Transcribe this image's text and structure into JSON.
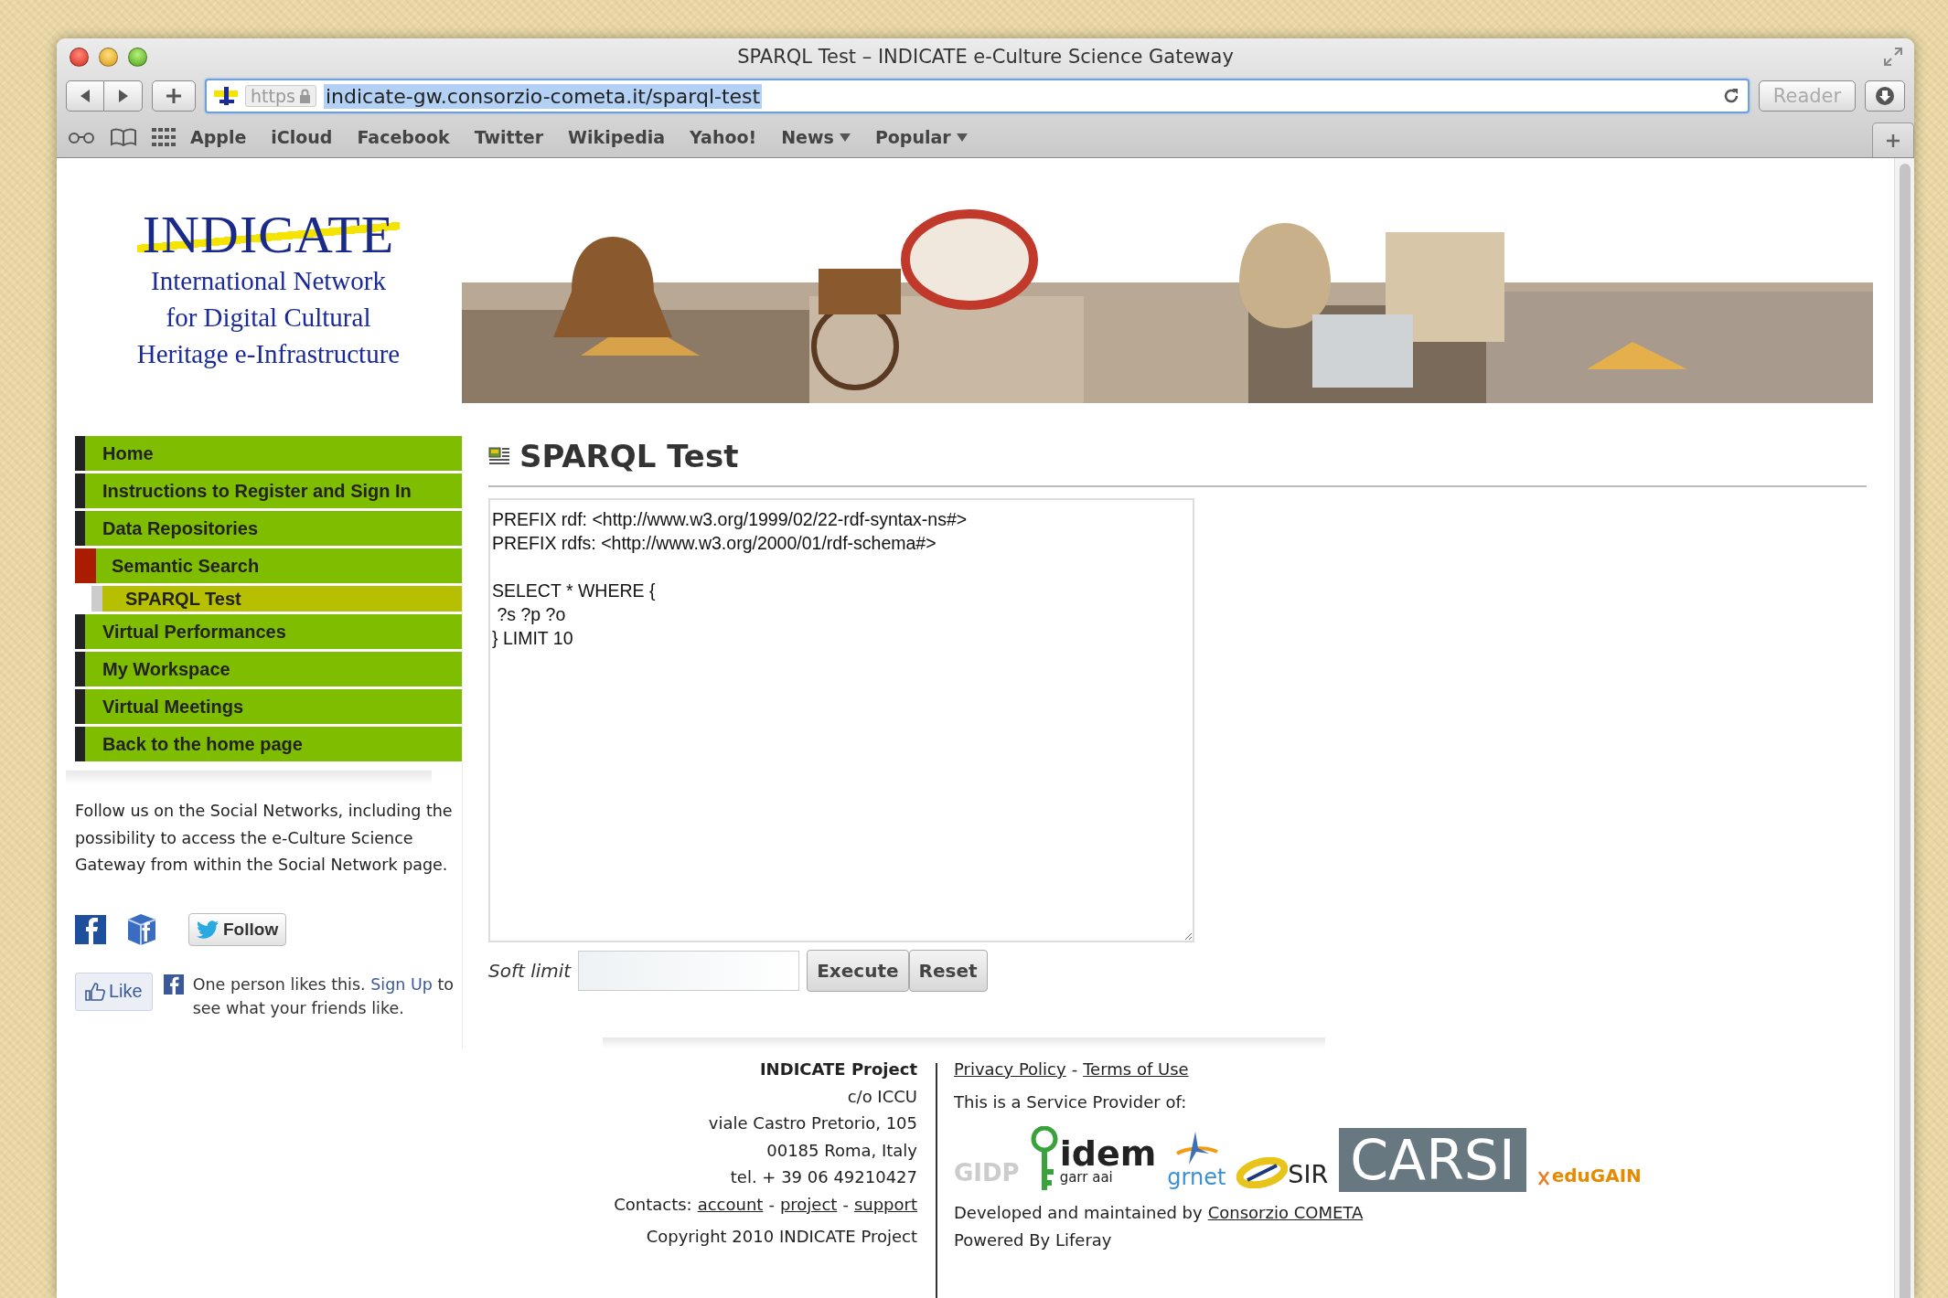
{
  "window": {
    "title": "SPARQL Test – INDICATE e-Culture Science Gateway"
  },
  "toolbar": {
    "scheme": "https",
    "url": "indicate-gw.consorzio-cometa.it/sparql-test",
    "url_selected": true,
    "reader": {
      "label": "Reader",
      "disabled": true
    }
  },
  "bookmarks": [
    {
      "label": "Apple",
      "kind": "link"
    },
    {
      "label": "iCloud",
      "kind": "link"
    },
    {
      "label": "Facebook",
      "kind": "link"
    },
    {
      "label": "Twitter",
      "kind": "link"
    },
    {
      "label": "Wikipedia",
      "kind": "link"
    },
    {
      "label": "Yahoo!",
      "kind": "link"
    },
    {
      "label": "News",
      "kind": "menu"
    },
    {
      "label": "Popular",
      "kind": "menu"
    }
  ],
  "logo": {
    "wordmark": "INDICATE",
    "lines": [
      "International Network",
      "for Digital Cultural",
      "Heritage e-Infrastructure"
    ]
  },
  "banner": {
    "kind": "picture"
  },
  "nav": [
    {
      "label": "Home",
      "selected": false,
      "expanded": false
    },
    {
      "label": "Instructions to Register and Sign In",
      "selected": false,
      "expanded": false
    },
    {
      "label": "Data Repositories",
      "selected": false,
      "expanded": false
    },
    {
      "label": "Semantic Search",
      "selected": false,
      "expanded": true,
      "children": [
        {
          "label": "SPARQL Test",
          "selected": true
        }
      ]
    },
    {
      "label": "Virtual Performances",
      "selected": false,
      "expanded": false
    },
    {
      "label": "My Workspace",
      "selected": false,
      "expanded": false
    },
    {
      "label": "Virtual Meetings",
      "selected": false,
      "expanded": false
    },
    {
      "label": "Back to the home page",
      "selected": false,
      "expanded": false
    }
  ],
  "social": {
    "text": "Follow us on the Social Networks, including the possibility to access the e-Culture Science Gateway from within the Social Network page.",
    "follow": "Follow"
  },
  "like": {
    "button": "Like",
    "before": "One person likes this.",
    "link": "Sign Up",
    "after": "to see what your friends like."
  },
  "page_title": "SPARQL Test",
  "query": {
    "value": "PREFIX rdf: <http://www.w3.org/1999/02/22-rdf-syntax-ns#>\nPREFIX rdfs: <http://www.w3.org/2000/01/rdf-schema#>\n\nSELECT * WHERE {\n ?s ?p ?o\n} LIMIT 10"
  },
  "soft_limit": {
    "label": "Soft limit"
  },
  "buttons": [
    "Execute",
    "Reset"
  ],
  "footer": {
    "name": "INDICATE Project",
    "address": [
      "c/o ICCU",
      "viale Castro Pretorio, 105",
      "00185 Roma, Italy",
      "tel. + 39 06 49210427"
    ],
    "contacts_label": "Contacts:",
    "separator": "-",
    "contacts": [
      "account",
      "project",
      "support"
    ],
    "copyright": "Copyright 2010 INDICATE Project",
    "policy_links": [
      "Privacy Policy",
      "Terms of Use"
    ],
    "provider_text": "This is a Service Provider of:",
    "providers": [
      {
        "kind": "gidp",
        "label": "GIDP"
      },
      {
        "kind": "idem",
        "label": "idem",
        "sublabel": "garr aai"
      },
      {
        "kind": "grnet",
        "label": "grnet"
      },
      {
        "kind": "sir",
        "label": "SIR"
      },
      {
        "kind": "carsi",
        "label": "CARSI"
      },
      {
        "kind": "edugain",
        "label": "eduGAIN"
      }
    ],
    "developed_text": "Developed and maintained by",
    "developed_link": "Consorzio COMETA",
    "powered": "Powered By Liferay"
  }
}
